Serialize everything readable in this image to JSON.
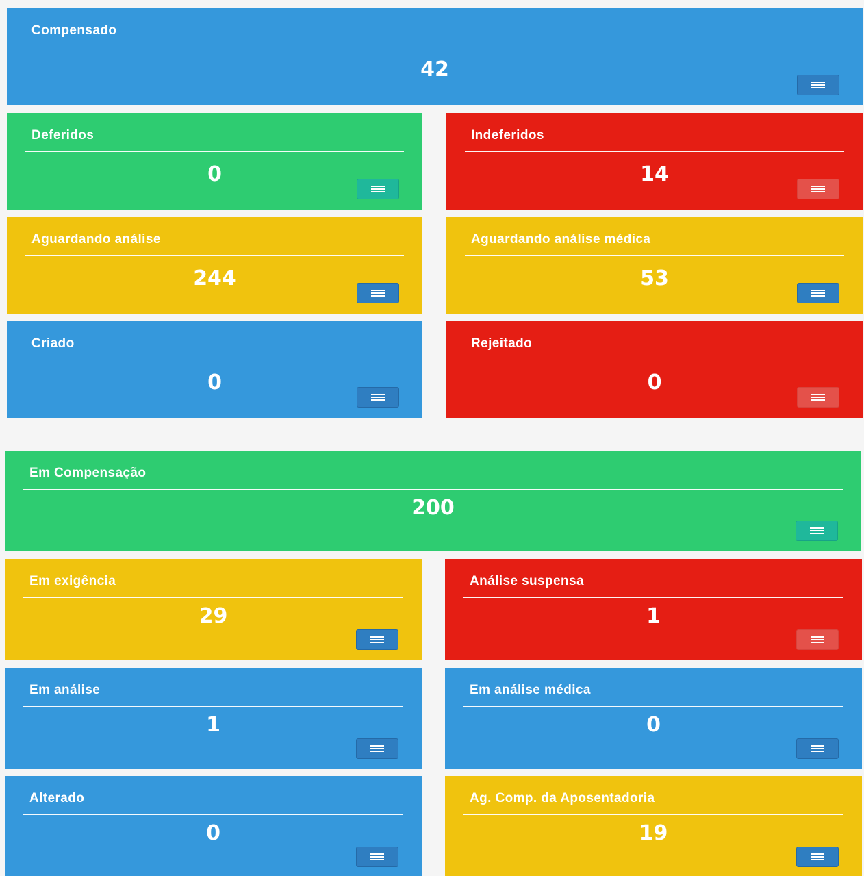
{
  "group1": {
    "compensado": {
      "title": "Compensado",
      "value": "42",
      "button_icon": "list-icon"
    },
    "deferidos": {
      "title": "Deferidos",
      "value": "0",
      "button_icon": "list-icon"
    },
    "indeferidos": {
      "title": "Indeferidos",
      "value": "14",
      "button_icon": "list-icon"
    },
    "aguardando_analise": {
      "title": "Aguardando análise",
      "value": "244",
      "button_icon": "list-icon"
    },
    "aguardando_analise_medica": {
      "title": "Aguardando análise médica",
      "value": "53",
      "button_icon": "list-icon"
    },
    "criado": {
      "title": "Criado",
      "value": "0",
      "button_icon": "list-icon"
    },
    "rejeitado": {
      "title": "Rejeitado",
      "value": "0",
      "button_icon": "list-icon"
    }
  },
  "group2": {
    "em_compensacao": {
      "title": "Em Compensação",
      "value": "200",
      "button_icon": "list-icon"
    },
    "em_exigencia": {
      "title": "Em exigência",
      "value": "29",
      "button_icon": "list-icon"
    },
    "analise_suspensa": {
      "title": "Análise suspensa",
      "value": "1",
      "button_icon": "list-icon"
    },
    "em_analise": {
      "title": "Em análise",
      "value": "1",
      "button_icon": "list-icon"
    },
    "em_analise_medica": {
      "title": "Em análise médica",
      "value": "0",
      "button_icon": "list-icon"
    },
    "alterado": {
      "title": "Alterado",
      "value": "0",
      "button_icon": "list-icon"
    },
    "ag_comp_aposentadoria": {
      "title": "Ag. Comp. da Aposentadoria",
      "value": "19",
      "button_icon": "list-icon"
    }
  },
  "colors": {
    "blue": "#3598dc",
    "green": "#2ecc71",
    "red": "#e51e14",
    "yellow": "#f0c30e",
    "page_background": "#f5f5f5"
  }
}
